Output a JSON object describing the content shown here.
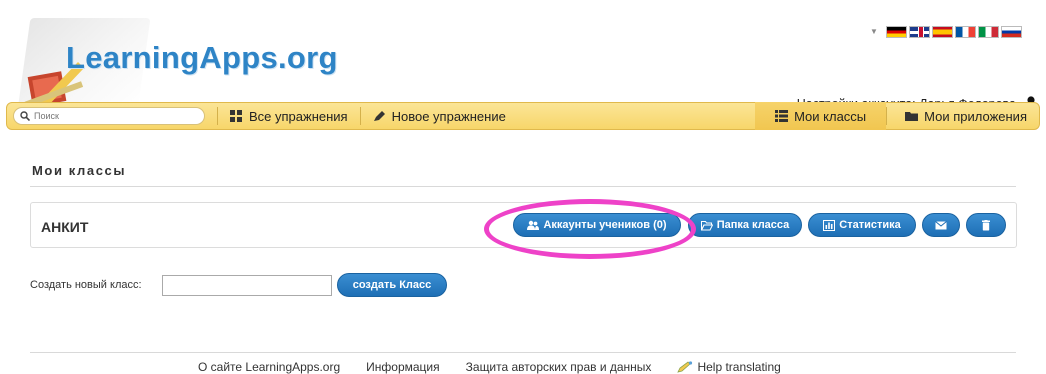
{
  "logo": {
    "text": "LearningApps.org"
  },
  "languages": [
    "german-flag",
    "english-flag",
    "spanish-flag",
    "french-flag",
    "italian-flag",
    "russian-flag"
  ],
  "account": {
    "label": "Настройки аккаунта: Дарья Федорова"
  },
  "nav": {
    "search_placeholder": "Поиск",
    "all_exercises": "Все упражнения",
    "new_exercise": "Новое упражнение",
    "my_classes": "Мои классы",
    "my_apps": "Мои приложения"
  },
  "page": {
    "title": "Мои классы"
  },
  "class": {
    "name": "АНКИТ",
    "buttons": {
      "student_accounts": "Аккаунты учеников (0)",
      "class_folder": "Папка класса",
      "statistics": "Статистика"
    }
  },
  "create": {
    "label": "Создать новый класс:",
    "input_value": "",
    "button": "создать Класс"
  },
  "footer": {
    "about": "О сайте LearningApps.org",
    "info": "Информация",
    "copyright": "Защита авторских прав и данных",
    "help": "Help translating"
  },
  "colors": {
    "accent": "#2e84c6",
    "navbar": "#f7d66a",
    "button": "#1e6fb5",
    "highlight": "#ee42c8"
  }
}
